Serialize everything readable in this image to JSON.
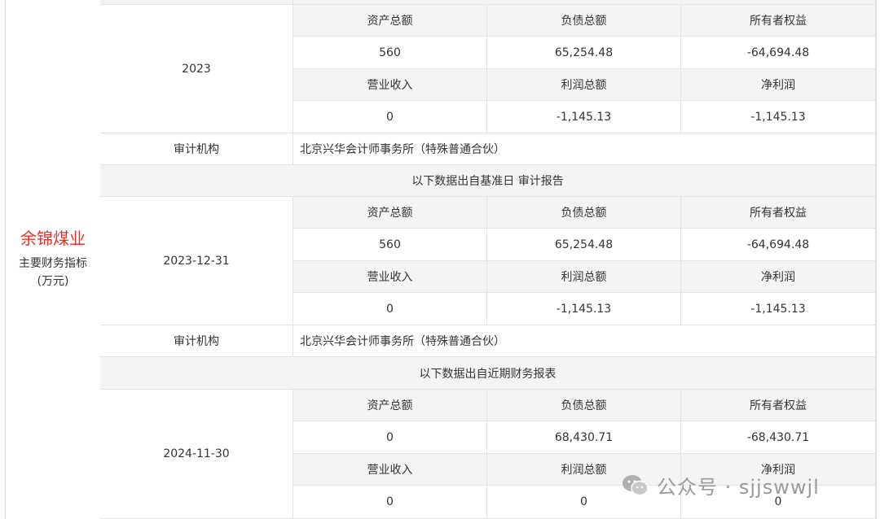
{
  "company": "余锦煤业",
  "subtitle_line1": "主要财务指标",
  "subtitle_line2": "(万元)",
  "audit_label": "审计机构",
  "audit_firm": "北京兴华会计师事务所（特殊普通合伙）",
  "headers_row1": [
    "资产总额",
    "负债总额",
    "所有者权益"
  ],
  "headers_row2": [
    "营业收入",
    "利润总额",
    "净利润"
  ],
  "sections": [
    {
      "period": "2023",
      "row1": [
        "560",
        "65,254.48",
        "-64,694.48"
      ],
      "row2": [
        "0",
        "-1,145.13",
        "-1,145.13"
      ]
    },
    {
      "period": "2023-12-31",
      "row1": [
        "560",
        "65,254.48",
        "-64,694.48"
      ],
      "row2": [
        "0",
        "-1,145.13",
        "-1,145.13"
      ]
    },
    {
      "period": "2024-11-30",
      "row1": [
        "0",
        "68,430.71",
        "-68,430.71"
      ],
      "row2": [
        "0",
        "0",
        "0"
      ]
    }
  ],
  "banner_audit": "以下数据出自基准日 审计报告",
  "banner_recent": "以下数据出自近期财务报表",
  "watermark": "公众号 · sjjswwjl",
  "watermark_icon": "wechat-icon"
}
